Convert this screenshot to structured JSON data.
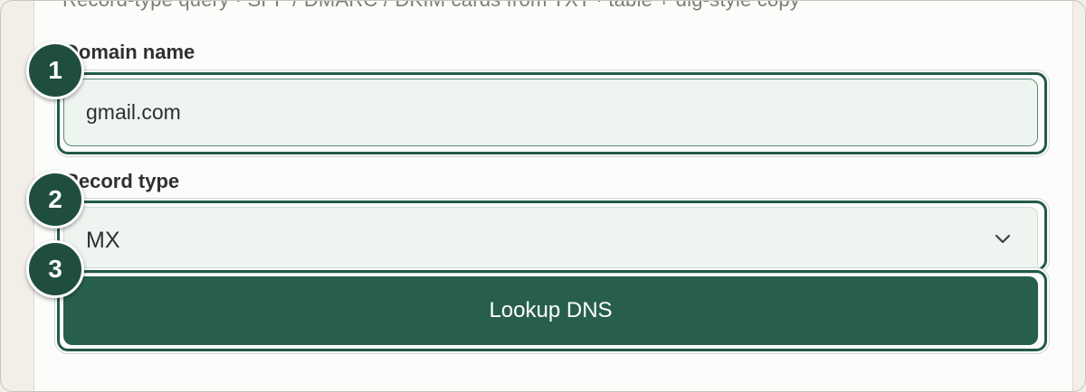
{
  "form": {
    "subheader": "Record-type query · SPF / DMARC / DKIM cards from TXT · table + dig-style copy",
    "domain": {
      "label": "Domain name",
      "value": "gmail.com"
    },
    "record_type": {
      "label": "Record type",
      "selected": "MX"
    },
    "lookup_button": {
      "label": "Lookup DNS"
    }
  },
  "annotations": {
    "badges": [
      "1",
      "2",
      "3"
    ]
  },
  "colors": {
    "accent": "#285f4c",
    "badge": "#1f4e3e",
    "input_bg": "#eef4ef",
    "highlight_border": "#235a48"
  },
  "icons": {
    "select_indicator": "chevron-down-icon"
  }
}
